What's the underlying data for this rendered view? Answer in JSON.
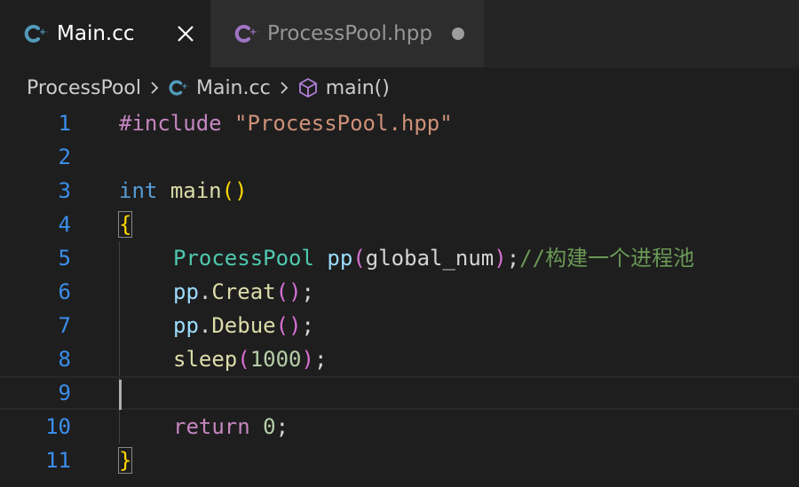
{
  "tabs": [
    {
      "label": "Main.cc",
      "active": true
    },
    {
      "label": "ProcessPool.hpp",
      "modified": true
    }
  ],
  "breadcrumb": {
    "folder": "ProcessPool",
    "file": "Main.cc",
    "symbol": "main()"
  },
  "colors": {
    "accent": "#3b8eea",
    "background": "#1e1e1e",
    "tabbar": "#252526"
  },
  "lines": [
    {
      "n": "1",
      "t": [
        "#include ",
        "\"ProcessPool.hpp\""
      ]
    },
    {
      "n": "2",
      "t": []
    },
    {
      "n": "3",
      "t": [
        "int",
        " ",
        "main",
        "(",
        ")"
      ]
    },
    {
      "n": "4",
      "t": [
        "{"
      ]
    },
    {
      "n": "5",
      "t": [
        "ProcessPool",
        " ",
        "pp",
        "(",
        "global_num",
        ")",
        ";",
        "//构建一个进程池"
      ]
    },
    {
      "n": "6",
      "t": [
        "pp",
        ".",
        "Creat",
        "(",
        ")",
        ";"
      ]
    },
    {
      "n": "7",
      "t": [
        "pp",
        ".",
        "Debue",
        "(",
        ")",
        ";"
      ]
    },
    {
      "n": "8",
      "t": [
        "sleep",
        "(",
        "1000",
        ")",
        ";"
      ]
    },
    {
      "n": "9",
      "t": []
    },
    {
      "n": "10",
      "t": [
        "return",
        " ",
        "0",
        ";"
      ]
    },
    {
      "n": "11",
      "t": [
        "}"
      ]
    }
  ]
}
